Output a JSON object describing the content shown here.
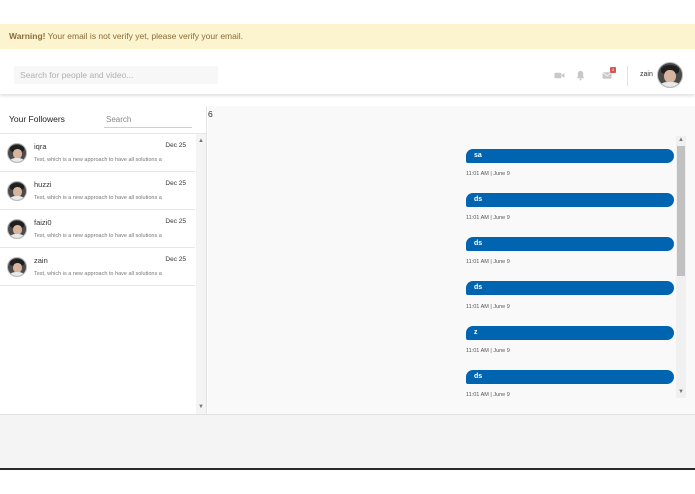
{
  "warning": {
    "strong": "Warning!",
    "message": " Your email is not verify yet, please verify your email."
  },
  "topbar": {
    "search_placeholder": "Search for people and video...",
    "icons": [
      "video-camera-icon",
      "bell-icon",
      "messages-icon"
    ],
    "message_badge": "2",
    "username": "zain"
  },
  "followers": {
    "title": "Your Followers",
    "search_placeholder": "Search",
    "items": [
      {
        "name": "iqra",
        "date": "Dec 25",
        "preview": "Test, which is a new approach to have all solutions a"
      },
      {
        "name": "huzzi",
        "date": "Dec 25",
        "preview": "Test, which is a new approach to have all solutions a"
      },
      {
        "name": "faizi0",
        "date": "Dec 25",
        "preview": "Test, which is a new approach to have all solutions a"
      },
      {
        "name": "zain",
        "date": "Dec 25",
        "preview": "Test, which is a new approach to have all solutions a"
      }
    ]
  },
  "chat": {
    "number": "6",
    "messages": [
      {
        "text": "sa",
        "time": "11:01 AM | June 9"
      },
      {
        "text": "ds",
        "time": "11:01 AM | June 9"
      },
      {
        "text": "ds",
        "time": "11:01 AM | June 9"
      },
      {
        "text": "ds",
        "time": "11:01 AM | June 9"
      },
      {
        "text": "z",
        "time": "11:01 AM | June 9"
      },
      {
        "text": "ds",
        "time": "11:01 AM | June 9"
      }
    ]
  },
  "colors": {
    "warning_bg": "#fcf3cf",
    "bubble": "#0064b0",
    "badge": "#d9534f"
  }
}
